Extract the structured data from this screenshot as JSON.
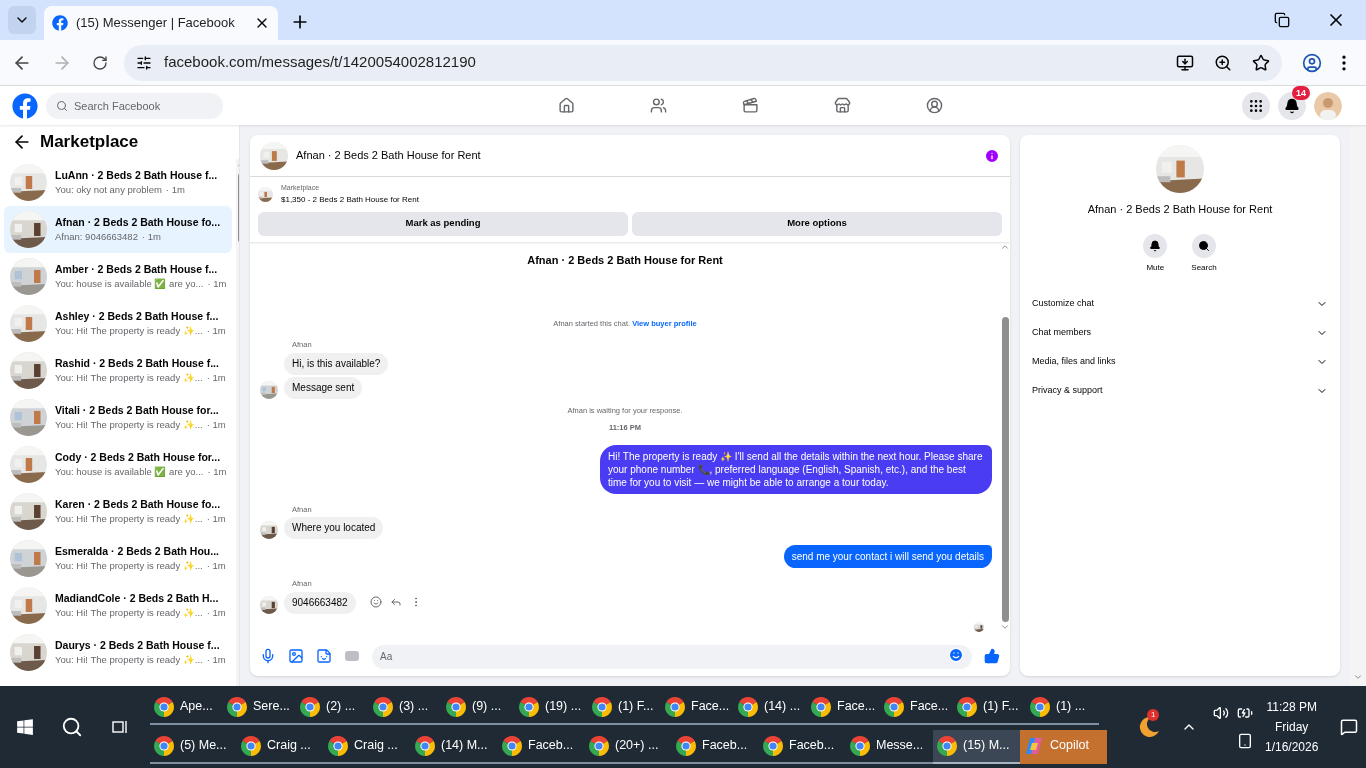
{
  "browser": {
    "tab_title": "(15) Messenger | Facebook",
    "url": "facebook.com/messages/t/1420054002812190"
  },
  "facebook_bar": {
    "search_placeholder": "Search Facebook",
    "notification_count": "14"
  },
  "sidebar": {
    "title": "Marketplace",
    "conversations": [
      {
        "name": "LuAnn · 2 Beds 2 Bath House f...",
        "preview": "You: oky not any problem",
        "time": "· 1m",
        "selected": false
      },
      {
        "name": "Afnan · 2 Beds 2 Bath House fo...",
        "preview": "Afnan: 9046663482",
        "time": "· 1m",
        "selected": true
      },
      {
        "name": "Amber · 2 Beds 2 Bath House f...",
        "preview": "You: house is available ✅ are yo...",
        "time": "· 1m",
        "selected": false
      },
      {
        "name": "Ashley · 2 Beds 2 Bath House f...",
        "preview": "You: Hi! The property is ready ✨...",
        "time": "· 1m",
        "selected": false
      },
      {
        "name": "Rashid · 2 Beds 2 Bath House f...",
        "preview": "You: Hi! The property is ready ✨...",
        "time": "· 1m",
        "selected": false
      },
      {
        "name": "Vitali · 2 Beds 2 Bath House for...",
        "preview": "You: Hi! The property is ready ✨...",
        "time": "· 1m",
        "selected": false
      },
      {
        "name": "Cody · 2 Beds 2 Bath House for...",
        "preview": "You: house is available ✅ are yo...",
        "time": "· 1m",
        "selected": false
      },
      {
        "name": "Karen · 2 Beds 2 Bath House fo...",
        "preview": "You: Hi! The property is ready ✨...",
        "time": "· 1m",
        "selected": false
      },
      {
        "name": "Esmeralda · 2 Beds 2 Bath Hou...",
        "preview": "You: Hi! The property is ready ✨...",
        "time": "· 1m",
        "selected": false
      },
      {
        "name": "MadiandCole · 2 Beds 2 Bath H...",
        "preview": "You: Hi! The property is ready ✨...",
        "time": "· 1m",
        "selected": false
      },
      {
        "name": "Daurys · 2 Beds 2 Bath House f...",
        "preview": "You: Hi! The property is ready ✨...",
        "time": "· 1m",
        "selected": false
      }
    ]
  },
  "chat": {
    "title": "Afnan · 2 Beds 2 Bath House for Rent",
    "listing_label": "Marketplace",
    "listing": "$1,350 - 2 Beds 2 Bath House for Rent",
    "buttons": [
      "Mark as pending",
      "More options"
    ],
    "messages": [
      {
        "kind": "title",
        "text": "Afnan · 2 Beds 2 Bath House for Rent"
      },
      {
        "kind": "system",
        "text": "Afnan started this chat.",
        "link": "View buyer profile"
      },
      {
        "kind": "sender",
        "text": "Afnan"
      },
      {
        "kind": "incoming",
        "text": "Hi, is this available?",
        "avatar": false,
        "actions": false
      },
      {
        "kind": "incoming",
        "text": "Message sent",
        "avatar": true,
        "actions": false
      },
      {
        "kind": "system",
        "text": "Afnan is waiting for your response."
      },
      {
        "kind": "timestamp",
        "text": "11:16 PM"
      },
      {
        "kind": "outgoing",
        "text": "Hi! The property is ready ✨ I'll send all the details within the next hour. Please share your phone number 📞, preferred language (English, Spanish, etc.), and the best time for you to visit — we might be able to arrange a tour today.",
        "color": "#4a3cf2"
      },
      {
        "kind": "sender",
        "text": "Afnan"
      },
      {
        "kind": "incoming",
        "text": "Where you located",
        "avatar": true,
        "actions": false
      },
      {
        "kind": "outgoing",
        "text": "send me your contact i will send you details",
        "color": "#0866ff"
      },
      {
        "kind": "sender",
        "text": "Afnan"
      },
      {
        "kind": "incoming",
        "text": "9046663482",
        "avatar": true,
        "actions": true
      }
    ],
    "composer_placeholder": "Aa"
  },
  "details": {
    "title": "Afnan · 2 Beds 2 Bath House for Rent",
    "actions": [
      {
        "kind": "mute",
        "label": "Mute"
      },
      {
        "kind": "search",
        "label": "Search"
      }
    ],
    "sections": [
      {
        "label": "Customize chat",
        "expanded": false
      },
      {
        "label": "Chat members",
        "expanded": false
      },
      {
        "label": "Media, files and links",
        "expanded": false
      },
      {
        "label": "Privacy & support",
        "expanded": false
      }
    ]
  },
  "taskbar": {
    "top_row": [
      {
        "label": "Ape...",
        "kind": "chrome",
        "selected": false
      },
      {
        "label": "Sere...",
        "kind": "chrome",
        "selected": false
      },
      {
        "label": "(2) ...",
        "kind": "chrome",
        "selected": false
      },
      {
        "label": "(3) ...",
        "kind": "chrome",
        "selected": false
      },
      {
        "label": "(9) ...",
        "kind": "chrome",
        "selected": false
      },
      {
        "label": "(19) ...",
        "kind": "chrome",
        "selected": false
      },
      {
        "label": "(1) F...",
        "kind": "chrome",
        "selected": false
      },
      {
        "label": "Face...",
        "kind": "chrome",
        "selected": false
      },
      {
        "label": "(14) ...",
        "kind": "chrome",
        "selected": false
      },
      {
        "label": "Face...",
        "kind": "chrome",
        "selected": false
      },
      {
        "label": "Face...",
        "kind": "chrome",
        "selected": false
      },
      {
        "label": "(1) F...",
        "kind": "chrome",
        "selected": false
      },
      {
        "label": "(1) ...",
        "kind": "chrome",
        "selected": false
      }
    ],
    "bottom_row": [
      {
        "label": "(5) Me...",
        "kind": "chrome",
        "selected": false
      },
      {
        "label": "Craig ...",
        "kind": "chrome",
        "selected": false
      },
      {
        "label": "Craig ...",
        "kind": "chrome",
        "selected": false
      },
      {
        "label": "(14) M...",
        "kind": "chrome",
        "selected": false
      },
      {
        "label": "Faceb...",
        "kind": "chrome",
        "selected": false
      },
      {
        "label": "(20+) ...",
        "kind": "chrome",
        "selected": false
      },
      {
        "label": "Faceb...",
        "kind": "chrome",
        "selected": false
      },
      {
        "label": "Faceb...",
        "kind": "chrome",
        "selected": false
      },
      {
        "label": "Messe...",
        "kind": "chrome",
        "selected": false
      },
      {
        "label": "(15) M...",
        "kind": "chrome",
        "selected": true
      },
      {
        "label": "Copilot",
        "kind": "copilot",
        "selected": false
      }
    ],
    "weather_badge": "1",
    "time": "11:28 PM",
    "day": "Friday",
    "date": "1/16/2026"
  }
}
